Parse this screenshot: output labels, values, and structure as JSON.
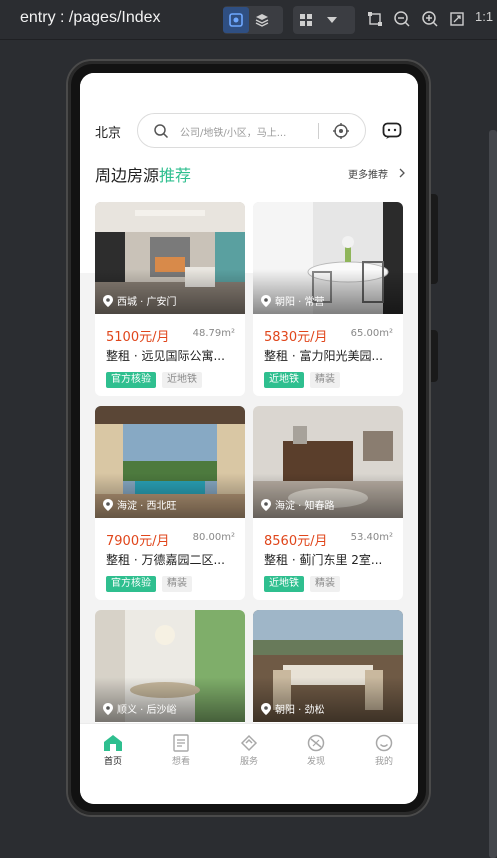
{
  "ide": {
    "title": "entry : /pages/Index",
    "ratio_label": "1:1",
    "toolbar_icons": [
      "inspect-icon",
      "layers-icon",
      "components-icon",
      "dropdown-icon",
      "bounds-icon",
      "zoom-out-icon",
      "zoom-in-icon",
      "fit-screen-icon"
    ]
  },
  "app": {
    "city": "北京",
    "search": {
      "placeholder": "公司/地铁/小区，马上..."
    },
    "section": {
      "title_main": "周边房源",
      "title_highlight": "推荐",
      "more_label": "更多推荐"
    },
    "colors": {
      "accent": "#2fbf8f",
      "price": "#e0461b"
    },
    "listings": [
      {
        "location": "西城 · 广安门",
        "price": "5100元/月",
        "area": "48.79m²",
        "title": "整租 · 远见国际公寓...",
        "tags": [
          "官方核验",
          "近地铁"
        ]
      },
      {
        "location": "朝阳 · 常营",
        "price": "5830元/月",
        "area": "65.00m²",
        "title": "整租 · 富力阳光美园...",
        "tags": [
          "近地铁",
          "精装"
        ]
      },
      {
        "location": "海淀 · 西北旺",
        "price": "7900元/月",
        "area": "80.00m²",
        "title": "整租 · 万德嘉园二区...",
        "tags": [
          "官方核验",
          "精装"
        ]
      },
      {
        "location": "海淀 · 知春路",
        "price": "8560元/月",
        "area": "53.40m²",
        "title": "整租 · 蓟门东里 2室...",
        "tags": [
          "近地铁",
          "精装"
        ]
      },
      {
        "location": "顺义 · 后沙峪",
        "price": "",
        "area": "",
        "title": "",
        "tags": []
      },
      {
        "location": "朝阳 · 劲松",
        "price": "",
        "area": "",
        "title": "",
        "tags": []
      }
    ],
    "tabs": [
      {
        "label": "首页",
        "icon": "home-icon",
        "active": true
      },
      {
        "label": "想看",
        "icon": "list-icon",
        "active": false
      },
      {
        "label": "服务",
        "icon": "service-icon",
        "active": false
      },
      {
        "label": "发现",
        "icon": "discover-icon",
        "active": false
      },
      {
        "label": "我的",
        "icon": "profile-icon",
        "active": false
      }
    ]
  }
}
